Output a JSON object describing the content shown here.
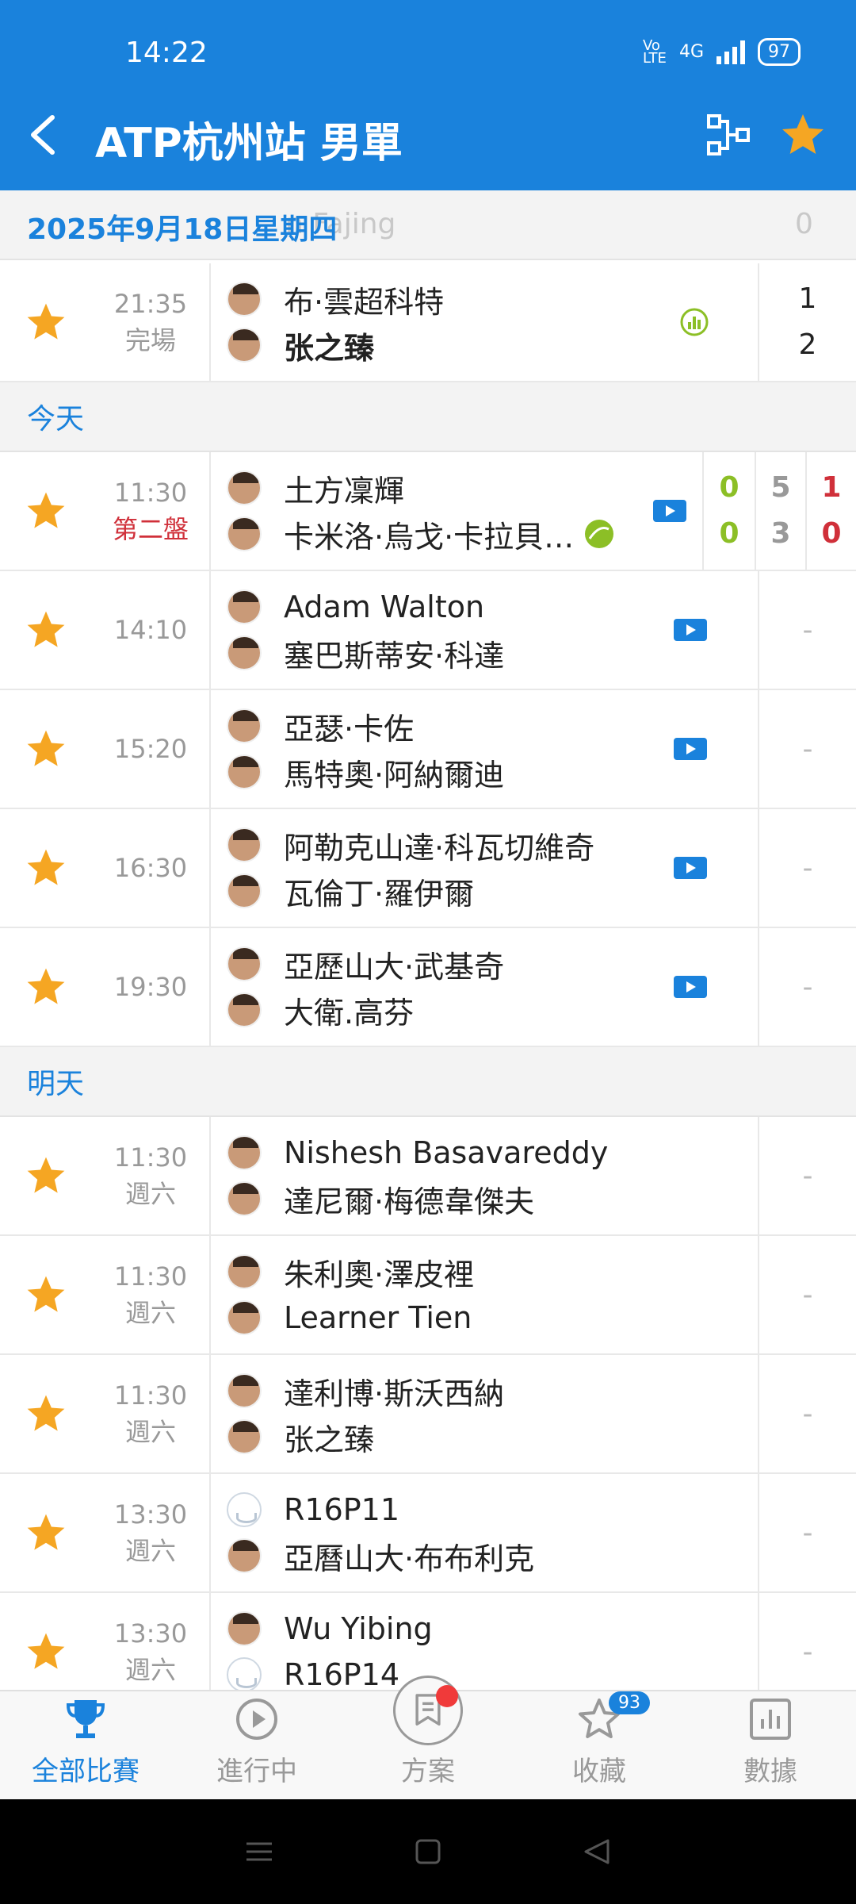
{
  "status_bar": {
    "time": "14:22",
    "network": "4G",
    "volte": "Vo LTE",
    "battery": "97"
  },
  "header": {
    "title": "ATP杭州站 男單"
  },
  "date_bar": {
    "date": "2025年9月18日星期四",
    "ghost_player": "n Fajing",
    "ghost_score": "0"
  },
  "past_match": {
    "time": "21:35",
    "status": "完場",
    "p1": "布·雲超科特",
    "p2": "张之臻",
    "s1": "1",
    "s2": "2"
  },
  "sections": {
    "today": "今天",
    "tomorrow": "明天"
  },
  "live_match": {
    "time": "11:30",
    "status": "第二盤",
    "p1": "土方凜輝",
    "p2": "卡米洛·烏戈·卡拉貝…",
    "points": [
      "0",
      "0"
    ],
    "set1": [
      "5",
      "3"
    ],
    "set2": [
      "1",
      "0"
    ]
  },
  "today_matches": [
    {
      "time": "14:10",
      "p1": "Adam Walton",
      "p2": "塞巴斯蒂安·科達",
      "score": "-"
    },
    {
      "time": "15:20",
      "p1": "亞瑟·卡佐",
      "p2": "馬特奧·阿納爾迪",
      "score": "-"
    },
    {
      "time": "16:30",
      "p1": "阿勒克山達·科瓦切維奇",
      "p2": "瓦倫丁·羅伊爾",
      "score": "-"
    },
    {
      "time": "19:30",
      "p1": "亞歷山大·武基奇",
      "p2": "大衛.高芬",
      "score": "-"
    }
  ],
  "tomorrow_matches": [
    {
      "time": "11:30",
      "day": "週六",
      "p1": "Nishesh Basavareddy",
      "p2": "達尼爾·梅德韋傑夫",
      "score": "-"
    },
    {
      "time": "11:30",
      "day": "週六",
      "p1": "朱利奧·澤皮裡",
      "p2": "Learner Tien",
      "score": "-"
    },
    {
      "time": "11:30",
      "day": "週六",
      "p1": "達利博·斯沃西納",
      "p2": "张之臻",
      "score": "-"
    },
    {
      "time": "13:30",
      "day": "週六",
      "p1": "R16P11",
      "p2": "亞曆山大·布布利克",
      "score": "-"
    },
    {
      "time": "13:30",
      "day": "週六",
      "p1": "Wu Yibing",
      "p2": "R16P14",
      "score": "-"
    }
  ],
  "tabs": [
    {
      "label": "全部比賽"
    },
    {
      "label": "進行中"
    },
    {
      "label": "方案"
    },
    {
      "label": "收藏",
      "badge": "93"
    },
    {
      "label": "數據"
    }
  ],
  "colors": {
    "primary": "#1a82dc",
    "star": "#f5a623",
    "live": "#d0303a",
    "points": "#8cbf26"
  }
}
